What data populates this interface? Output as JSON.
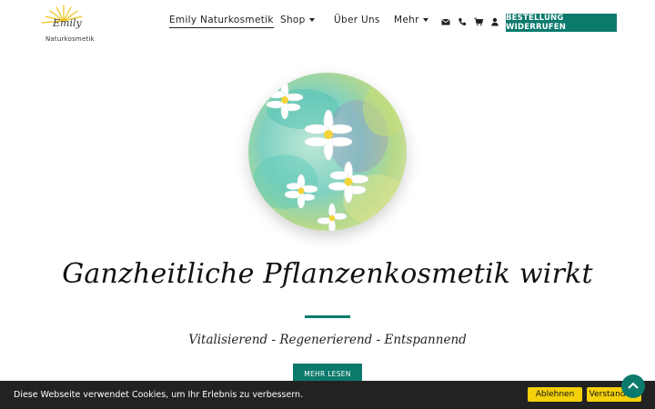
{
  "logo": {
    "script_name": "Emily",
    "subtitle": "Naturkosmetik",
    "icon": "sunrise-logo-icon"
  },
  "nav": {
    "items": [
      {
        "label": "Emily Naturkosmetik",
        "active": true
      },
      {
        "label": "Shop",
        "dropdown": true
      },
      {
        "label": "Über Uns"
      },
      {
        "label": "Mehr",
        "dropdown": true
      }
    ],
    "icons": [
      "envelope-icon",
      "phone-icon",
      "cart-icon",
      "user-icon"
    ],
    "cta_label": "BESTELLUNG WIDERRUFEN"
  },
  "hero": {
    "image": "daisy-watercolor-image",
    "headline": "Ganzheitliche Pflanzenkosmetik wirkt",
    "subline": "Vitalisierend - Regenerierend - Entspannend",
    "button_label": "MEHR LESEN"
  },
  "cookie": {
    "text": "Diese Webseite verwendet Cookies, um Ihr Erlebnis zu verbessern.",
    "decline_label": "Ablehnen",
    "accept_label": "Verstanden!"
  },
  "colors": {
    "accent": "#0b7a6c",
    "cookie_bg": "#222222",
    "cookie_button": "#f5d10a"
  }
}
